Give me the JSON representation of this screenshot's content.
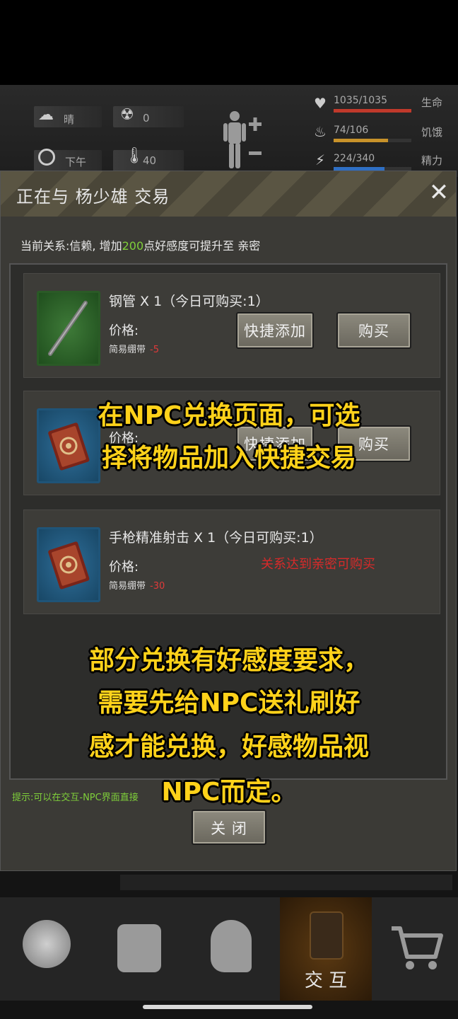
{
  "status": {
    "weather": "晴",
    "radiation": "0",
    "time_of_day": "下午",
    "temperature": "40",
    "health": {
      "value": "1035/1035",
      "label": "生命",
      "fraction": 1.0,
      "color": "#c0392b"
    },
    "hunger": {
      "value": "74/106",
      "label": "饥饿",
      "fraction": 0.698,
      "color": "#c8922a"
    },
    "energy": {
      "value": "224/340",
      "label": "精力",
      "fraction": 0.659,
      "color": "#2f6fc4"
    }
  },
  "dialog": {
    "title": "正在与 杨少雄 交易",
    "relation_prefix": "当前关系:信赖, 增加",
    "relation_points": "200",
    "relation_suffix": "点好感度可提升至 亲密",
    "items": [
      {
        "name": "钢管 X 1（今日可购买:1）",
        "price_label": "价格:",
        "currency": "简易绷带",
        "cost": "-5",
        "quick_add": "快捷添加",
        "buy": "购买",
        "icon": "pipe-icon"
      },
      {
        "name": "",
        "price_label": "价格:",
        "currency": "",
        "cost": "",
        "quick_add": "快捷添加",
        "buy": "购买",
        "icon": "book-icon"
      },
      {
        "name": "手枪精准射击 X 1（今日可购买:1）",
        "price_label": "价格:",
        "currency": "简易绷带",
        "cost": "-30",
        "requirement": "关系达到亲密可购买",
        "icon": "book-icon"
      }
    ],
    "hint": "提示:可以在交互-NPC界面直接",
    "close_label": "关 闭"
  },
  "nav": {
    "interact_label": "交 互"
  },
  "captions": {
    "top_line1": "在NPC兑换页面，可选",
    "top_line2": "择将物品加入快捷交易",
    "bottom_line1": "部分兑换有好感度要求，",
    "bottom_line2": "需要先给NPC送礼刷好",
    "bottom_line3": "感才能兑换，好感物品视",
    "bottom_line4": "NPC而定。"
  }
}
